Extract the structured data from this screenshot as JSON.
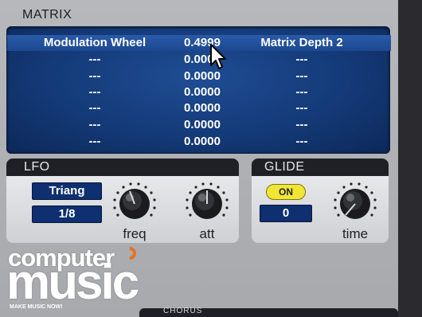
{
  "matrix": {
    "title": "MATRIX",
    "rows": [
      {
        "source": "Modulation Wheel",
        "value": "0.4999",
        "destination": "Matrix Depth 2"
      },
      {
        "source": "---",
        "value": "0.0000",
        "destination": "---"
      },
      {
        "source": "---",
        "value": "0.0000",
        "destination": "---"
      },
      {
        "source": "---",
        "value": "0.0000",
        "destination": "---"
      },
      {
        "source": "---",
        "value": "0.0000",
        "destination": "---"
      },
      {
        "source": "---",
        "value": "0.0000",
        "destination": "---"
      },
      {
        "source": "---",
        "value": "0.0000",
        "destination": "---"
      }
    ]
  },
  "lfo": {
    "title": "LFO",
    "waveform": "Triang",
    "rate": "1/8",
    "freq_label": "freq",
    "att_label": "att"
  },
  "glide": {
    "title": "GLIDE",
    "toggle_label": "ON",
    "value": "0",
    "time_label": "time"
  },
  "logo": {
    "line1": "computer",
    "line2": "music",
    "tagline": "MAKE MUSIC NOW!"
  },
  "bottom": {
    "label": "CHORUS"
  },
  "colors": {
    "panel_bg": "#a9aaad",
    "matrix_blue": "#143a78",
    "lcd_blue": "#0e2f70",
    "on_yellow": "#f1e634",
    "logo_orange": "#e8711f"
  }
}
